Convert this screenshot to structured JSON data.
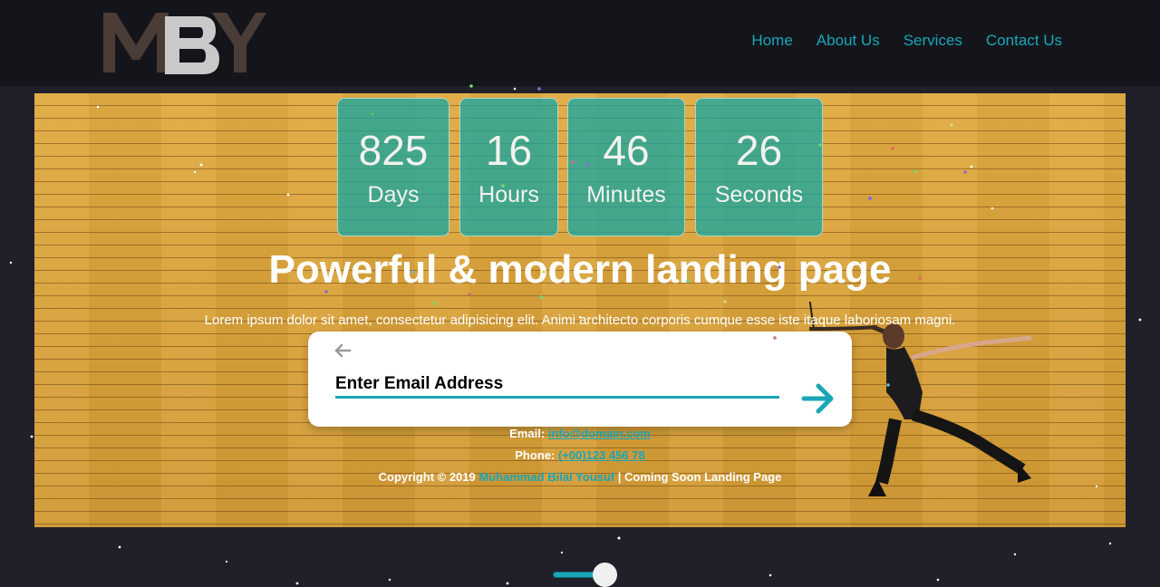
{
  "brand": {
    "logo_text": "MBY"
  },
  "nav": {
    "items": [
      {
        "label": "Home"
      },
      {
        "label": "About Us"
      },
      {
        "label": "Services"
      },
      {
        "label": "Contact Us"
      }
    ]
  },
  "countdown": [
    {
      "value": "825",
      "label": "Days"
    },
    {
      "value": "16",
      "label": "Hours"
    },
    {
      "value": "46",
      "label": "Minutes"
    },
    {
      "value": "26",
      "label": "Seconds"
    }
  ],
  "hero": {
    "title": "Powerful & modern landing page",
    "subtitle": "Lorem ipsum dolor sit amet, consectetur adipisicing elit. Animi architecto corporis cumque esse iste itaque laboriosam magni."
  },
  "subscribe": {
    "placeholder": "Enter Email Address",
    "back_icon": "arrow-left-icon",
    "submit_icon": "arrow-right-icon"
  },
  "footer": {
    "email_label": "Email:",
    "email_value": "info@domain.com",
    "phone_label": "Phone:",
    "phone_value": "(+00)123 456 78",
    "copyright_prefix": "Copyright © 2019",
    "author": "Muhammad Bilal Yousuf",
    "copyright_suffix": "| Coming Soon Landing Page"
  },
  "colors": {
    "accent": "#1aa6b6",
    "countdown_bg": "#1aa6a0",
    "nav_bg": "#14151b",
    "page_bg": "#1f2029",
    "hero_bg": "#d9a43c"
  }
}
